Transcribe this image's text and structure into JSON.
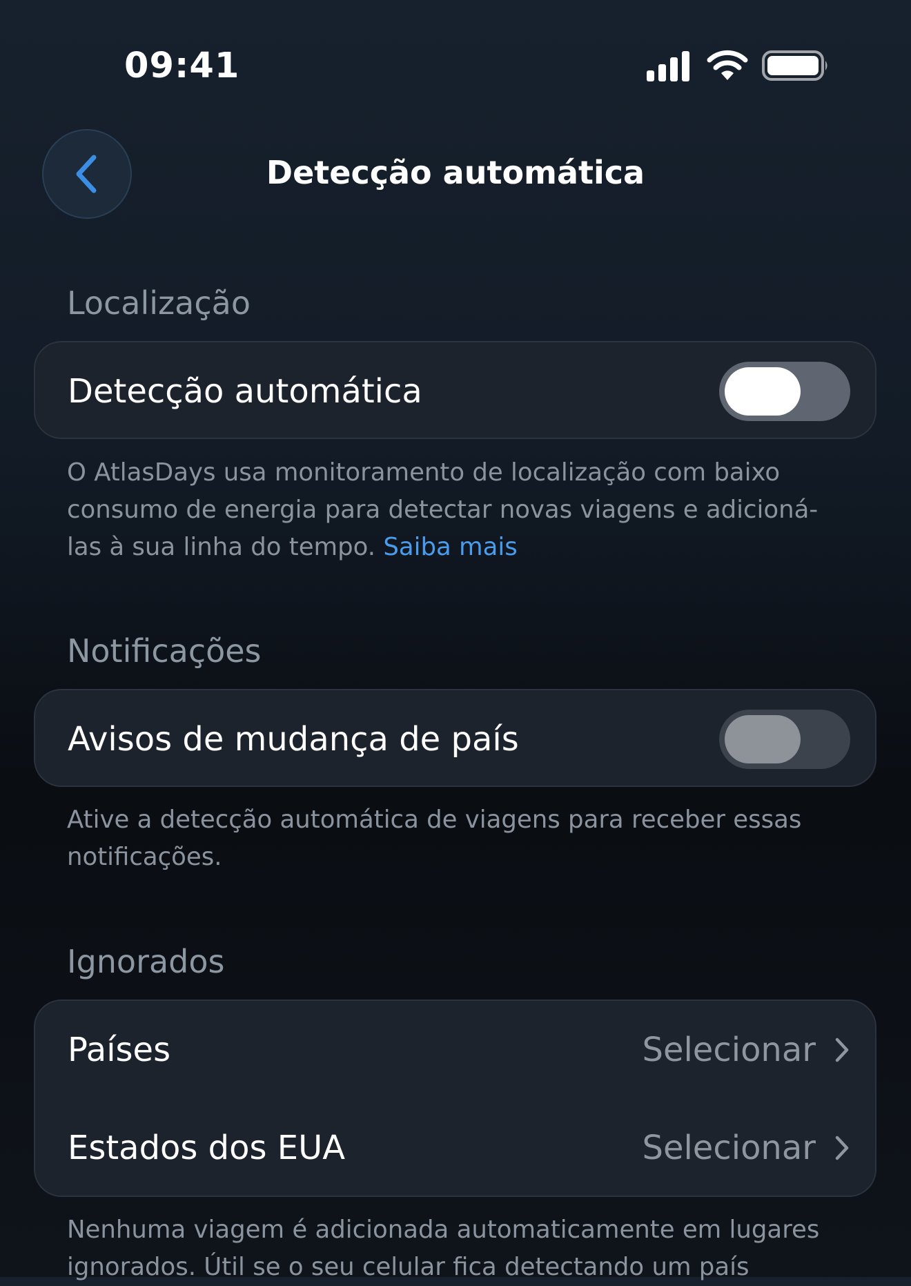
{
  "status_bar": {
    "time": "09:41",
    "icons": [
      "signal-icon",
      "wifi-icon",
      "battery-icon"
    ]
  },
  "nav": {
    "back_icon": "chevron-left-icon",
    "title": "Detecção automática"
  },
  "sections": {
    "location": {
      "header": "Localização",
      "row_label": "Detecção automática",
      "toggle_on": true,
      "footer_text": "O AtlasDays usa monitoramento de localização com baixo consumo de energia para detectar novas viagens e adicioná-las à sua linha do tempo. ",
      "footer_link": "Saiba mais"
    },
    "notifications": {
      "header": "Notificações",
      "row_label": "Avisos de mudança de país",
      "toggle_on": false,
      "footer_text": "Ative a detecção automática de viagens para receber essas notificações."
    },
    "ignored": {
      "header": "Ignorados",
      "rows": [
        {
          "label": "Países",
          "value": "Selecionar"
        },
        {
          "label": "Estados dos EUA",
          "value": "Selecionar"
        }
      ],
      "footer_text": "Nenhuma viagem é adicionada automaticamente em lugares ignorados. Útil se o seu celular fica detectando um país"
    }
  },
  "colors": {
    "accent": "#4a9cec",
    "card_background": "#1d232c",
    "secondary_text": "#8b949e"
  }
}
